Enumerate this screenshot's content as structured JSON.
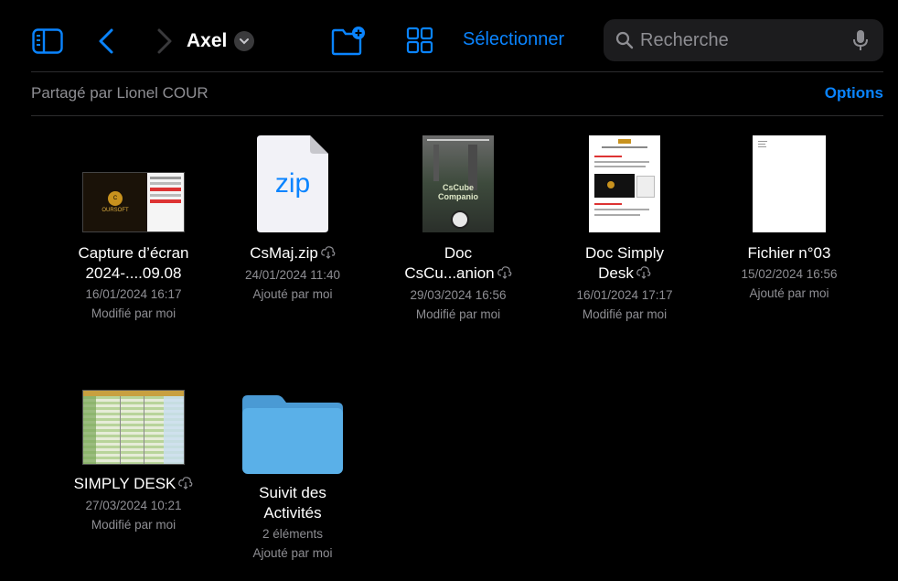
{
  "toolbar": {
    "title": "Axel",
    "select_label": "Sélectionner",
    "search_placeholder": "Recherche"
  },
  "header": {
    "shared_by": "Partagé par Lionel COUR",
    "options_label": "Options"
  },
  "colors": {
    "accent": "#0a84ff",
    "background": "#000000",
    "secondary_text": "#8e8e93",
    "folder": "#5ab0e8"
  },
  "items": [
    {
      "name_line1": "Capture d’écran",
      "name_line2": "2024-....09.08",
      "date": "16/01/2024 16:17",
      "by": "Modifié par moi",
      "thumb_icon": "screenshot-thumbnail",
      "thumb_text": "OURSOFT"
    },
    {
      "name_line1": "CsMaj.zip",
      "date": "24/01/2024 11:40",
      "by": "Ajouté par moi",
      "thumb_icon": "zip-file-icon",
      "thumb_text": "zip"
    },
    {
      "name_line1": "Doc",
      "name_line2": "CsCu...anion",
      "date": "29/03/2024 16:56",
      "by": "Modifié par moi",
      "thumb_icon": "document-thumbnail",
      "thumb_text": "CsCube Companio"
    },
    {
      "name_line1": "Doc Simply",
      "name_line2": "Desk",
      "date": "16/01/2024 17:17",
      "by": "Modifié par moi",
      "thumb_icon": "document-thumbnail"
    },
    {
      "name_line1": "Fichier n°03",
      "date": "15/02/2024 16:56",
      "by": "Ajouté par moi",
      "thumb_icon": "blank-document-thumbnail"
    },
    {
      "name_line1": "SIMPLY DESK",
      "date": "27/03/2024 10:21",
      "by": "Modifié par moi",
      "thumb_icon": "spreadsheet-thumbnail"
    },
    {
      "name_line1": "Suivit des",
      "name_line2": "Activités",
      "date": "2 éléments",
      "by": "Ajouté par moi",
      "thumb_icon": "folder-icon"
    }
  ]
}
